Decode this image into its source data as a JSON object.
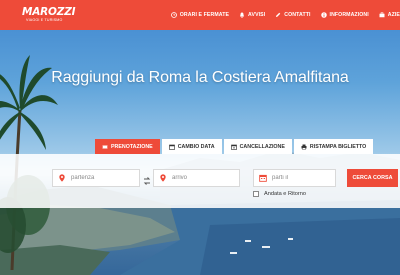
{
  "brand": {
    "name": "MAROZZI",
    "tagline": "VIAGGI E TURISMO"
  },
  "nav": {
    "items": [
      {
        "label": "ORARI E FERMATE",
        "icon": "clock-icon"
      },
      {
        "label": "AVVISI",
        "icon": "bell-icon"
      },
      {
        "label": "CONTATTI",
        "icon": "pencil-icon"
      },
      {
        "label": "INFORMAZIONI",
        "icon": "info-icon"
      },
      {
        "label": "AZIE",
        "icon": "briefcase-icon"
      }
    ]
  },
  "hero": {
    "title": "Raggiungi da Roma la Costiera Amalfitana"
  },
  "tabs": [
    {
      "label": "PRENOTAZIONE",
      "icon": "ticket-icon",
      "active": true
    },
    {
      "label": "CAMBIO DATA",
      "icon": "calendar-icon",
      "active": false
    },
    {
      "label": "CANCELLAZIONE",
      "icon": "calendar-x-icon",
      "active": false
    },
    {
      "label": "RISTAMPA BIGLIETTO",
      "icon": "printer-icon",
      "active": false
    }
  ],
  "search": {
    "departure_placeholder": "partenza",
    "arrival_placeholder": "arrivo",
    "date_placeholder": "parti il",
    "submit_label": "CERCA CORSA",
    "round_trip_label": "Andata e Ritorno"
  },
  "colors": {
    "brand_red": "#ee4b39",
    "sky": "#5d9fd6"
  }
}
